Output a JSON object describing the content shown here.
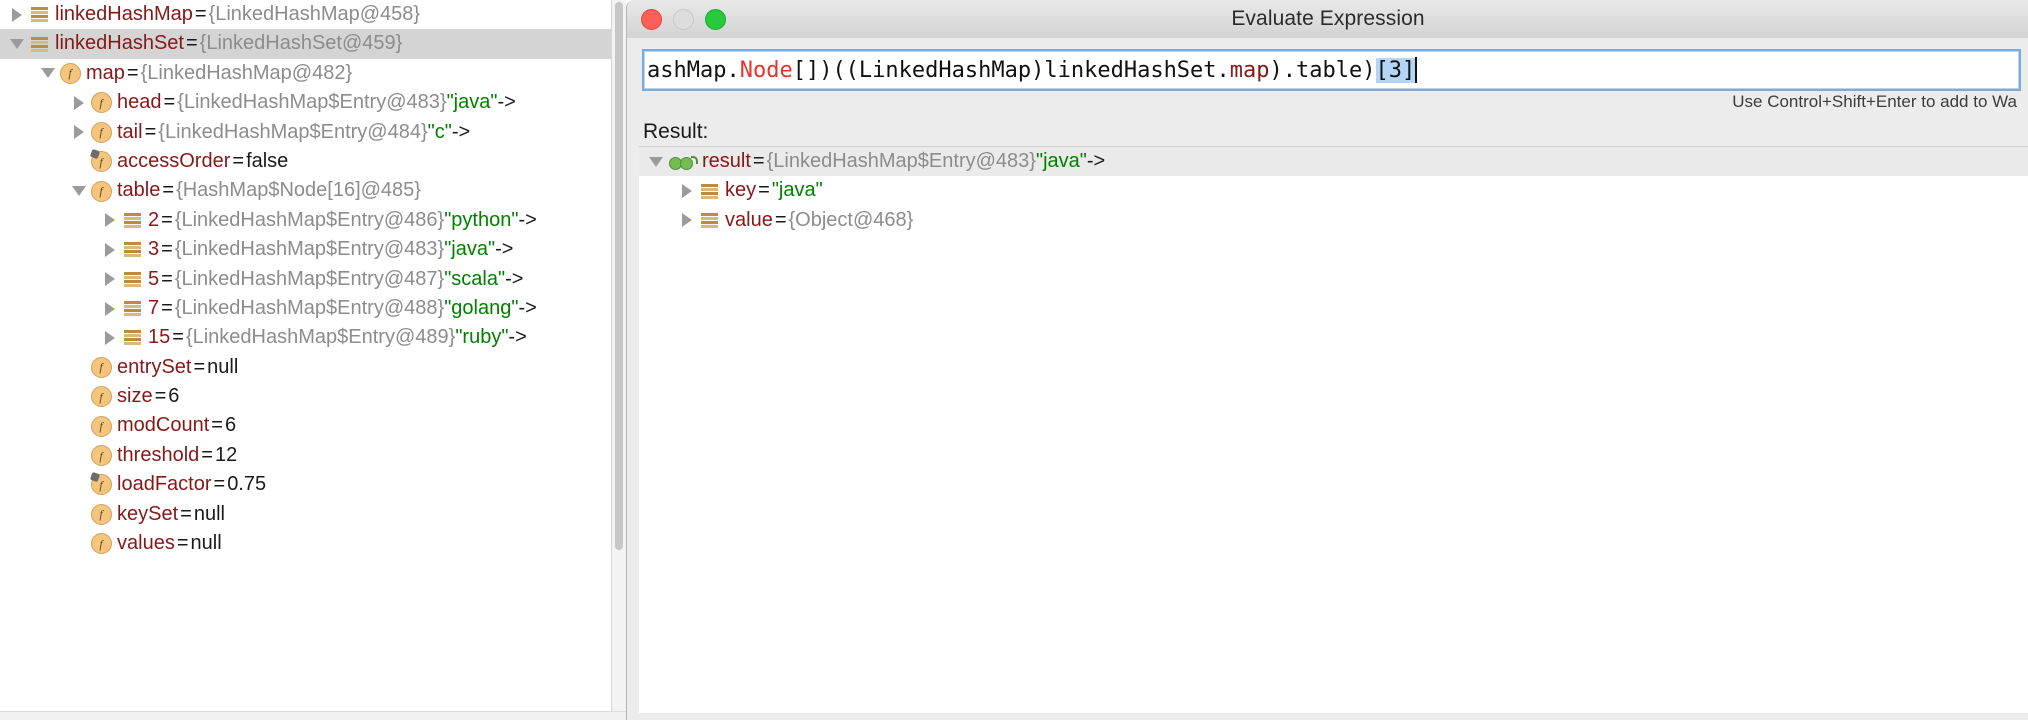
{
  "variables_panel": {
    "rows": [
      {
        "indent": 0,
        "toggle": "collapsed",
        "icon": "collection-icon",
        "name": "linkedHashMap",
        "eq": "=",
        "ref": "{LinkedHashMap@458}",
        "str": "",
        "arrow": "",
        "value": "",
        "selected": false
      },
      {
        "indent": 0,
        "toggle": "expanded",
        "icon": "collection-icon",
        "name": "linkedHashSet",
        "eq": "=",
        "ref": "{LinkedHashSet@459}",
        "str": "",
        "arrow": "",
        "value": "",
        "selected": true
      },
      {
        "indent": 1,
        "toggle": "expanded",
        "icon": "field-icon",
        "name": "map",
        "eq": "=",
        "ref": "{LinkedHashMap@482}",
        "str": "",
        "arrow": "",
        "value": "",
        "selected": false
      },
      {
        "indent": 2,
        "toggle": "collapsed",
        "icon": "field-icon",
        "name": "head",
        "eq": "=",
        "ref": "{LinkedHashMap$Entry@483}",
        "str": "\"java\"",
        "arrow": "->",
        "value": "",
        "selected": false
      },
      {
        "indent": 2,
        "toggle": "collapsed",
        "icon": "field-icon",
        "name": "tail",
        "eq": "=",
        "ref": "{LinkedHashMap$Entry@484}",
        "str": "\"c\"",
        "arrow": "->",
        "value": "",
        "selected": false
      },
      {
        "indent": 2,
        "toggle": "none",
        "icon": "field-final-icon",
        "name": "accessOrder",
        "eq": "=",
        "ref": "",
        "str": "",
        "arrow": "",
        "value": "false",
        "selected": false
      },
      {
        "indent": 2,
        "toggle": "expanded",
        "icon": "field-icon",
        "name": "table",
        "eq": "=",
        "ref": "{HashMap$Node[16]@485}",
        "str": "",
        "arrow": "",
        "value": "",
        "selected": false
      },
      {
        "indent": 3,
        "toggle": "collapsed",
        "icon": "collection-icon",
        "name": "2",
        "eq": "=",
        "ref": "{LinkedHashMap$Entry@486}",
        "str": "\"python\"",
        "arrow": "->",
        "value": "",
        "selected": false
      },
      {
        "indent": 3,
        "toggle": "collapsed",
        "icon": "collection-icon",
        "name": "3",
        "eq": "=",
        "ref": "{LinkedHashMap$Entry@483}",
        "str": "\"java\"",
        "arrow": "->",
        "value": "",
        "selected": false
      },
      {
        "indent": 3,
        "toggle": "collapsed",
        "icon": "collection-icon",
        "name": "5",
        "eq": "=",
        "ref": "{LinkedHashMap$Entry@487}",
        "str": "\"scala\"",
        "arrow": "->",
        "value": "",
        "selected": false
      },
      {
        "indent": 3,
        "toggle": "collapsed",
        "icon": "collection-icon",
        "name": "7",
        "eq": "=",
        "ref": "{LinkedHashMap$Entry@488}",
        "str": "\"golang\"",
        "arrow": "->",
        "value": "",
        "selected": false
      },
      {
        "indent": 3,
        "toggle": "collapsed",
        "icon": "collection-icon",
        "name": "15",
        "eq": "=",
        "ref": "{LinkedHashMap$Entry@489}",
        "str": "\"ruby\"",
        "arrow": "->",
        "value": "",
        "selected": false
      },
      {
        "indent": 2,
        "toggle": "none",
        "icon": "field-icon",
        "name": "entrySet",
        "eq": "=",
        "ref": "",
        "str": "",
        "arrow": "",
        "value": "null",
        "selected": false
      },
      {
        "indent": 2,
        "toggle": "none",
        "icon": "field-icon",
        "name": "size",
        "eq": "=",
        "ref": "",
        "str": "",
        "arrow": "",
        "value": "6",
        "selected": false
      },
      {
        "indent": 2,
        "toggle": "none",
        "icon": "field-icon",
        "name": "modCount",
        "eq": "=",
        "ref": "",
        "str": "",
        "arrow": "",
        "value": "6",
        "selected": false
      },
      {
        "indent": 2,
        "toggle": "none",
        "icon": "field-icon",
        "name": "threshold",
        "eq": "=",
        "ref": "",
        "str": "",
        "arrow": "",
        "value": "12",
        "selected": false
      },
      {
        "indent": 2,
        "toggle": "none",
        "icon": "field-final-icon",
        "name": "loadFactor",
        "eq": "=",
        "ref": "",
        "str": "",
        "arrow": "",
        "value": "0.75",
        "selected": false
      },
      {
        "indent": 2,
        "toggle": "none",
        "icon": "field-icon",
        "name": "keySet",
        "eq": "=",
        "ref": "",
        "str": "",
        "arrow": "",
        "value": "null",
        "selected": false
      },
      {
        "indent": 2,
        "toggle": "none",
        "icon": "field-icon",
        "name": "values",
        "eq": "=",
        "ref": "",
        "str": "",
        "arrow": "",
        "value": "null",
        "selected": false
      }
    ]
  },
  "dialog": {
    "title": "Evaluate Expression",
    "window_controls": {
      "close": "close-button",
      "minimize": "minimize-button",
      "zoom": "zoom-button"
    },
    "expression": {
      "visible_text": "ashMap.Node[])((LinkedHashMap)linkedHashSet.map).table)[3]",
      "segments": [
        {
          "text": "ashMap.",
          "cls": "plain"
        },
        {
          "text": "Node",
          "cls": "kw-red"
        },
        {
          "text": "[])((LinkedHashMap)linkedHashSet.",
          "cls": "plain"
        },
        {
          "text": "map",
          "cls": "fld"
        },
        {
          "text": ").table)",
          "cls": "plain"
        },
        {
          "text": "[3]",
          "cls": "selidx"
        }
      ]
    },
    "hint": "Use Control+Shift+Enter to add to Wa",
    "result_label": "Result:",
    "result_rows": [
      {
        "indent": 0,
        "toggle": "expanded",
        "icon": "watch-glasses-icon",
        "name": "result",
        "eq": "=",
        "ref": "{LinkedHashMap$Entry@483}",
        "str": "\"java\"",
        "arrow": "->",
        "value": "",
        "highlight": true
      },
      {
        "indent": 1,
        "toggle": "collapsed",
        "icon": "collection-icon",
        "name": "key",
        "eq": "=",
        "ref": "",
        "str": "\"java\"",
        "arrow": "",
        "value": "",
        "highlight": false
      },
      {
        "indent": 1,
        "toggle": "collapsed",
        "icon": "collection-icon",
        "name": "value",
        "eq": "=",
        "ref": "{Object@468}",
        "str": "",
        "arrow": "",
        "value": "",
        "highlight": false
      }
    ]
  },
  "colors": {
    "name": "#871818",
    "reference": "#8c8c8c",
    "string": "#008000",
    "selection": "#d4d4d4",
    "focus_border": "#7aabdd",
    "keyword_red": "#e8322a",
    "index_selection": "#b4d5f5"
  }
}
